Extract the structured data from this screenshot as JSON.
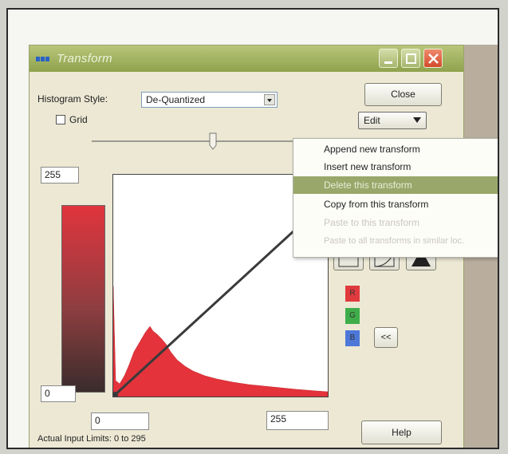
{
  "window": {
    "title": "Transform",
    "min_icon": "minimize-icon",
    "max_icon": "maximize-icon",
    "close_icon": "close-icon"
  },
  "controls": {
    "histogram_style_label": "Histogram Style:",
    "histogram_style_value": "De-Quantized",
    "grid_label": "Grid",
    "grid_checked": false,
    "close_button": "Close",
    "edit_button": "Edit",
    "help_button": "Help",
    "collapse_button": "<<",
    "output_max": "255",
    "output_min": "0",
    "input_min": "0",
    "input_max": "255",
    "status": "Actual Input Limits: 0 to 295"
  },
  "channels": [
    {
      "label": "R",
      "color": "#e03a3e"
    },
    {
      "label": "G",
      "color": "#3fae4a"
    },
    {
      "label": "B",
      "color": "#4d78d8"
    }
  ],
  "context_menu": {
    "items": [
      {
        "label": "Append new transform",
        "enabled": true,
        "highlighted": false
      },
      {
        "label": "Insert new transform",
        "enabled": true,
        "highlighted": false
      },
      {
        "label": "Delete this transform",
        "enabled": true,
        "highlighted": true
      },
      {
        "label": "Copy from this transform",
        "enabled": true,
        "highlighted": false
      },
      {
        "label": "Paste to this transform",
        "enabled": false,
        "highlighted": false
      },
      {
        "label": "Paste to all transforms in similar loc.",
        "enabled": false,
        "highlighted": false
      }
    ]
  },
  "colors": {
    "histogram_fill": "#e4333b",
    "menu_highlight": "#99a86a",
    "titlebar": "#a3b361"
  }
}
